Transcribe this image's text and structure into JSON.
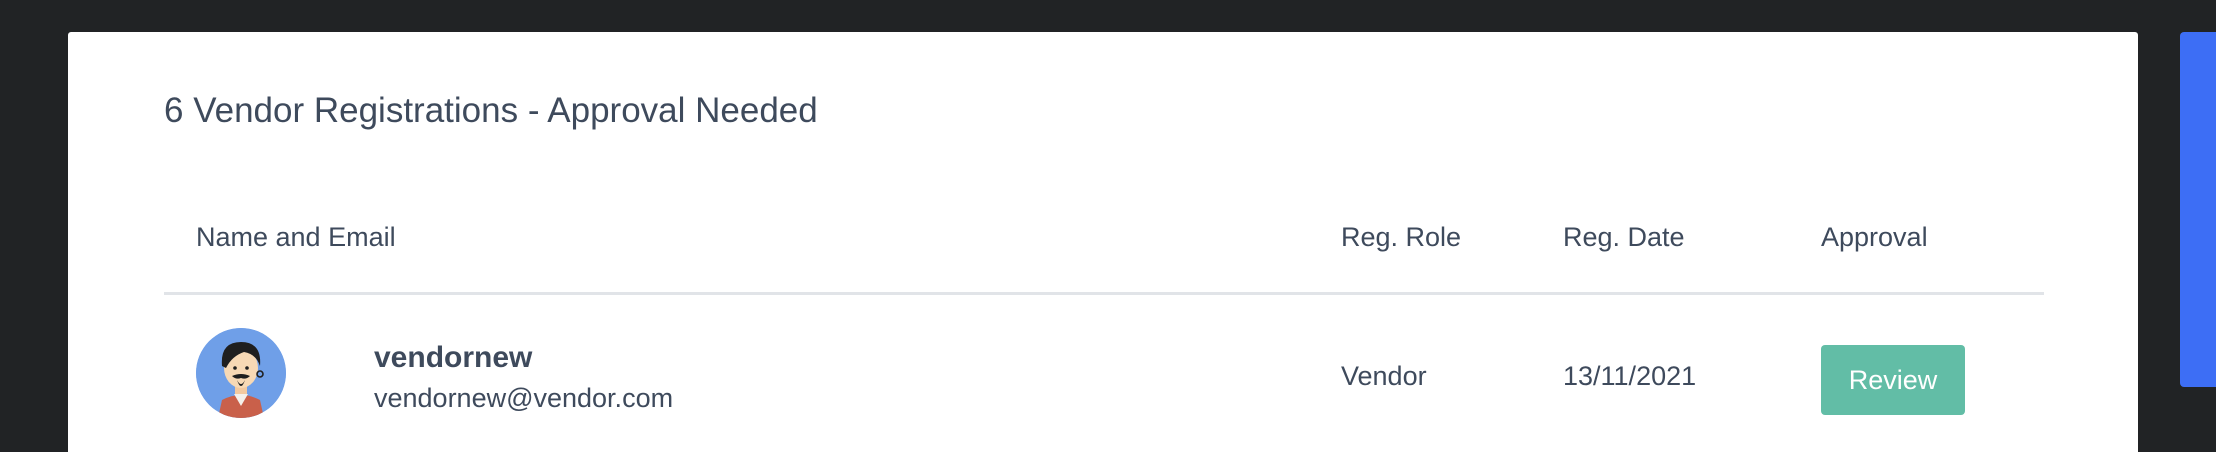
{
  "header": {
    "title": "6 Vendor Registrations - Approval Needed"
  },
  "table": {
    "columns": {
      "name_email": "Name and Email",
      "role": "Reg. Role",
      "date": "Reg. Date",
      "approval": "Approval"
    },
    "rows": [
      {
        "avatar_icon": "avatar-person-icon",
        "name": "vendornew",
        "email": "vendornew@vendor.com",
        "role": "Vendor",
        "date": "13/11/2021",
        "action_label": "Review"
      }
    ]
  },
  "colors": {
    "background": "#212325",
    "card": "#ffffff",
    "accent": "#3d6ef5",
    "review_button": "#62bda6",
    "text": "#3e4a5c"
  }
}
